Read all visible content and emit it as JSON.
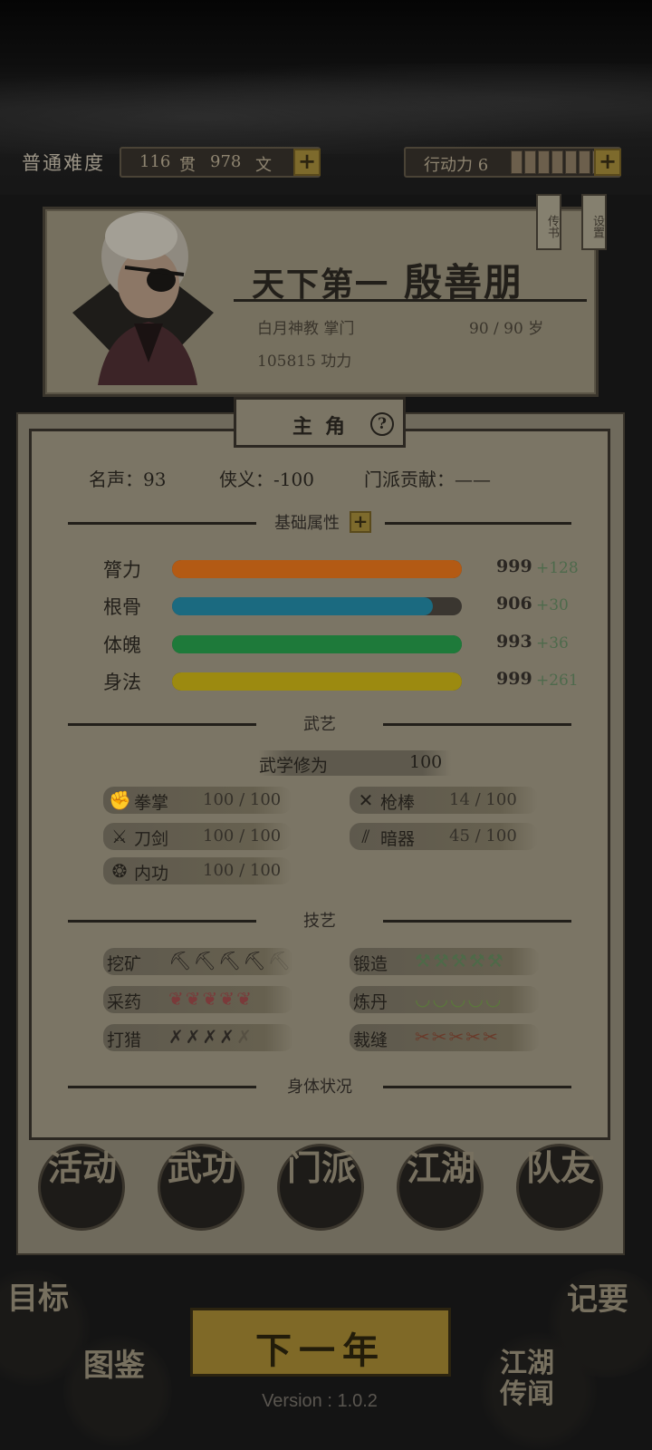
{
  "top_bar": {
    "difficulty": "普通难度",
    "money_guan": "116",
    "money_guan_unit": "贯",
    "money_wen": "978",
    "money_wen_unit": "文",
    "stamina_label": "行动力 6",
    "stamina_cells": 7
  },
  "profile": {
    "title": "天下第一",
    "name": "殷善朋",
    "sect_role": "白月神教 掌门",
    "age": "90 / 90 岁",
    "power": "105815 功力",
    "tag_letters": "传书",
    "tag_settings": "设置"
  },
  "panel": {
    "tab_label": "主角",
    "help": "?",
    "reputation": "名声：93",
    "chivalry": "侠义：-100",
    "sect_contribution": "门派贡献：——"
  },
  "sections": {
    "base_attributes": "基础属性",
    "martial": "武艺",
    "crafts": "技艺",
    "health": "身体状况"
  },
  "attributes": [
    {
      "label": "膂力",
      "value": "999",
      "bonus": "+128",
      "fill": 1.0,
      "color": "#b35a14"
    },
    {
      "label": "根骨",
      "value": "906",
      "bonus": "+30",
      "fill": 0.9,
      "color": "#1b6a80"
    },
    {
      "label": "体魄",
      "value": "993",
      "bonus": "+36",
      "fill": 1.0,
      "color": "#1e7a3a"
    },
    {
      "label": "身法",
      "value": "999",
      "bonus": "+261",
      "fill": 1.0,
      "color": "#9c8a10"
    }
  ],
  "mastery": {
    "label": "武学修为",
    "value": "100"
  },
  "skills": [
    {
      "label": "拳掌",
      "value": "100 / 100",
      "icon": "fist-icon",
      "glyph": "✊"
    },
    {
      "label": "枪棒",
      "value": "14 / 100",
      "icon": "spear-icon",
      "glyph": "✕"
    },
    {
      "label": "刀剑",
      "value": "100 / 100",
      "icon": "sword-icon",
      "glyph": "⚔"
    },
    {
      "label": "暗器",
      "value": "45 / 100",
      "icon": "dart-icon",
      "glyph": "⫽"
    },
    {
      "label": "内功",
      "value": "100 / 100",
      "icon": "qi-icon",
      "glyph": "❂"
    }
  ],
  "crafts": [
    {
      "label": "挖矿",
      "level": 4,
      "max": 5,
      "icon": "pickaxe-icon",
      "glyph": "⛏",
      "color": "#2a2622"
    },
    {
      "label": "锻造",
      "level": 5,
      "max": 5,
      "icon": "anvil-icon",
      "glyph": "⚒",
      "color": "#4d6a48"
    },
    {
      "label": "采药",
      "level": 5,
      "max": 5,
      "icon": "herb-icon",
      "glyph": "❦",
      "color": "#7a3a3a"
    },
    {
      "label": "炼丹",
      "level": 5,
      "max": 5,
      "icon": "bowl-icon",
      "glyph": "◡",
      "color": "#5a7a3a"
    },
    {
      "label": "打猎",
      "level": 4,
      "max": 5,
      "icon": "bow-icon",
      "glyph": "✗",
      "color": "#2a2622"
    },
    {
      "label": "裁缝",
      "level": 5,
      "max": 5,
      "icon": "needle-icon",
      "glyph": "✂",
      "color": "#6a3a2a"
    }
  ],
  "actions": [
    "活动",
    "武功",
    "门派",
    "江湖",
    "队友"
  ],
  "bottom": {
    "goal": "目标",
    "codex": "图鉴",
    "next_year": "下一年",
    "notes": "记要",
    "rumors": "江湖传闻",
    "version": "Version : 1.0.2"
  },
  "colors": {
    "accent_gold": "#7f6927",
    "panel_bg": "#7b7565",
    "ink": "#221f1a"
  }
}
